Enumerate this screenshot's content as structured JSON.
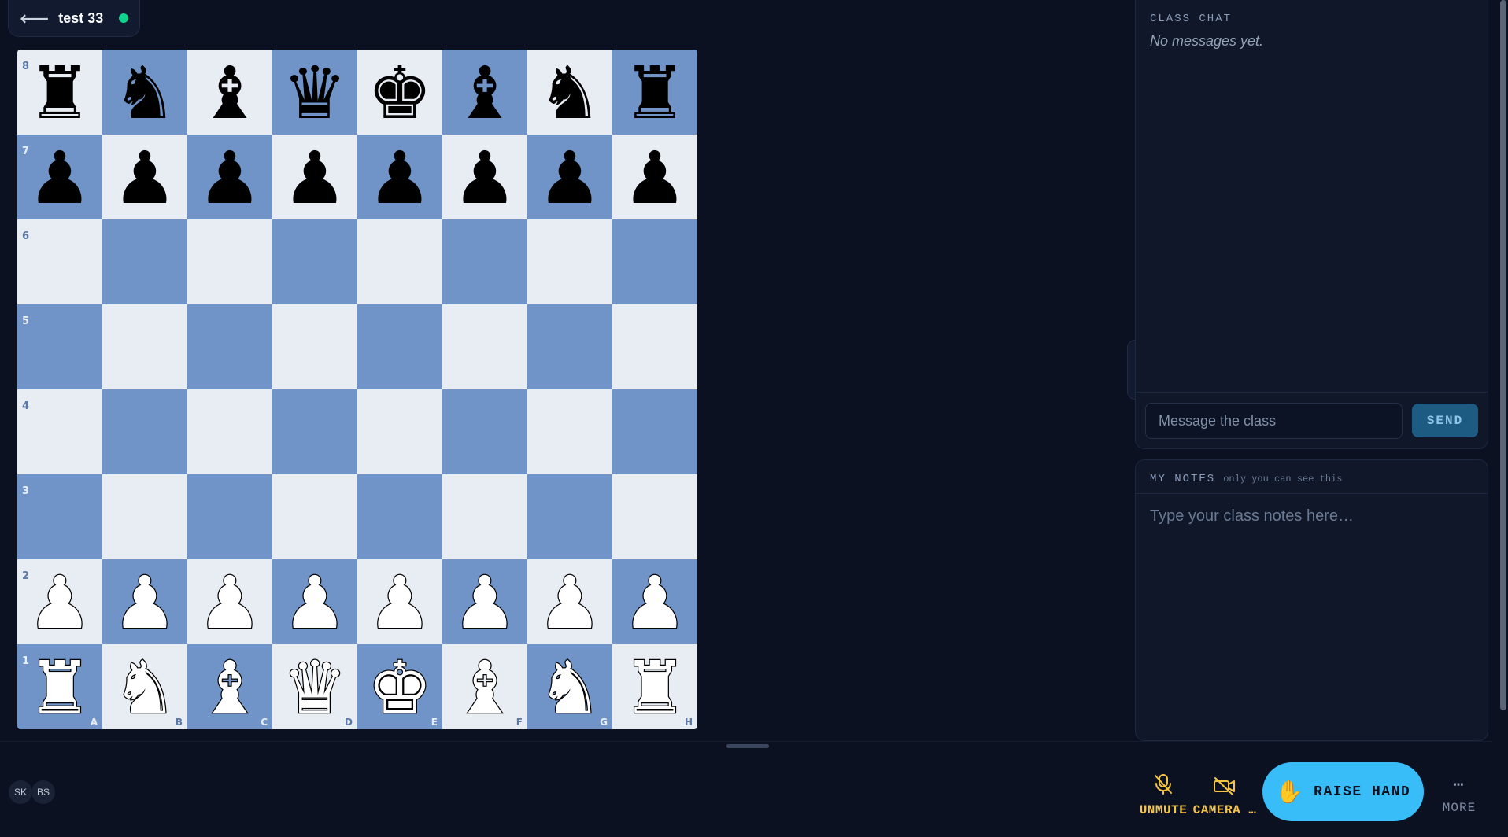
{
  "room": {
    "title": "test 33",
    "back_icon": "arrow-left-icon",
    "status": "live"
  },
  "board": {
    "ranks": [
      "8",
      "7",
      "6",
      "5",
      "4",
      "3",
      "2",
      "1"
    ],
    "files": [
      "A",
      "B",
      "C",
      "D",
      "E",
      "F",
      "G",
      "H"
    ],
    "colors": {
      "light": "#e8edf4",
      "dark": "#7094c8"
    },
    "position": [
      [
        "r",
        "n",
        "b",
        "q",
        "k",
        "b",
        "n",
        "r"
      ],
      [
        "p",
        "p",
        "p",
        "p",
        "p",
        "p",
        "p",
        "p"
      ],
      [
        "",
        "",
        "",
        "",
        "",
        "",
        "",
        ""
      ],
      [
        "",
        "",
        "",
        "",
        "",
        "",
        "",
        ""
      ],
      [
        "",
        "",
        "",
        "",
        "",
        "",
        "",
        ""
      ],
      [
        "",
        "",
        "",
        "",
        "",
        "",
        "",
        ""
      ],
      [
        "P",
        "P",
        "P",
        "P",
        "P",
        "P",
        "P",
        "P"
      ],
      [
        "R",
        "N",
        "B",
        "Q",
        "K",
        "B",
        "N",
        "R"
      ]
    ]
  },
  "chat": {
    "heading": "CLASS CHAT",
    "empty_text": "No messages yet.",
    "input_placeholder": "Message the class",
    "send_label": "SEND"
  },
  "notes": {
    "heading": "MY NOTES",
    "subheading": "only you can see this",
    "placeholder": "Type your class notes here…"
  },
  "participants": [
    "SK",
    "BS"
  ],
  "controls": {
    "unmute_label": "UNMUTE",
    "camera_label": "CAMERA …",
    "raise_hand_label": "RAISE HAND",
    "more_label": "MORE"
  },
  "colors": {
    "accent_yellow": "#f5c542",
    "raise_hand_bg": "#38bdf8",
    "live_dot": "#10d48e"
  }
}
